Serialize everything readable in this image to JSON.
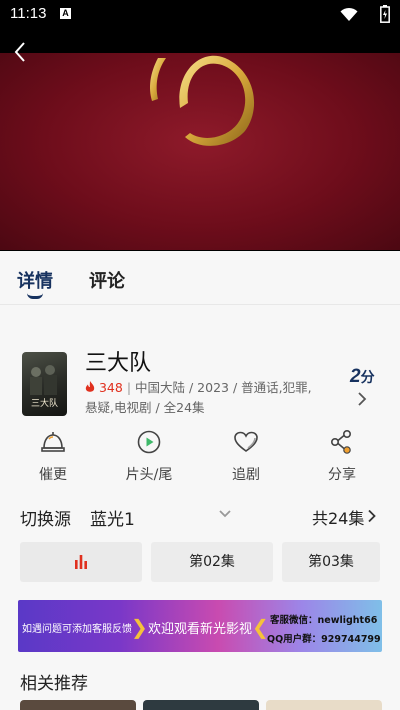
{
  "status_bar": {
    "time": "11:13",
    "notification_icon": "A"
  },
  "tabs": [
    {
      "label": "详情"
    },
    {
      "label": "评论"
    }
  ],
  "show": {
    "title": "三大队",
    "poster_text": "三大队",
    "heat": "348",
    "meta_line1": "中国大陆 / 2023 / 普通话,犯罪,",
    "meta_line2": "悬疑,电视剧 / 全24集",
    "score_value": "2",
    "score_unit": "分"
  },
  "actions": [
    {
      "label": "催更",
      "icon": "bell-icon"
    },
    {
      "label": "片头/尾",
      "icon": "play-circle-icon"
    },
    {
      "label": "追剧",
      "icon": "heart-icon"
    },
    {
      "label": "分享",
      "icon": "share-icon"
    }
  ],
  "source": {
    "label": "切换源",
    "name": "蓝光1",
    "episode_count": "共24集"
  },
  "episodes": [
    {
      "label": "",
      "playing": true
    },
    {
      "label": "第02集"
    },
    {
      "label": "第03集"
    }
  ],
  "banner": {
    "left_text": "如遇问题可添加客服反馈",
    "center_text": "欢迎观看新光影视",
    "wechat": "客服微信：newlight66",
    "qq": "QQ用户群：929744799"
  },
  "related_title": "相关推荐",
  "colors": {
    "accent": "#17325f",
    "heat": "#e0301e",
    "playing_bars": "#e0301e"
  }
}
